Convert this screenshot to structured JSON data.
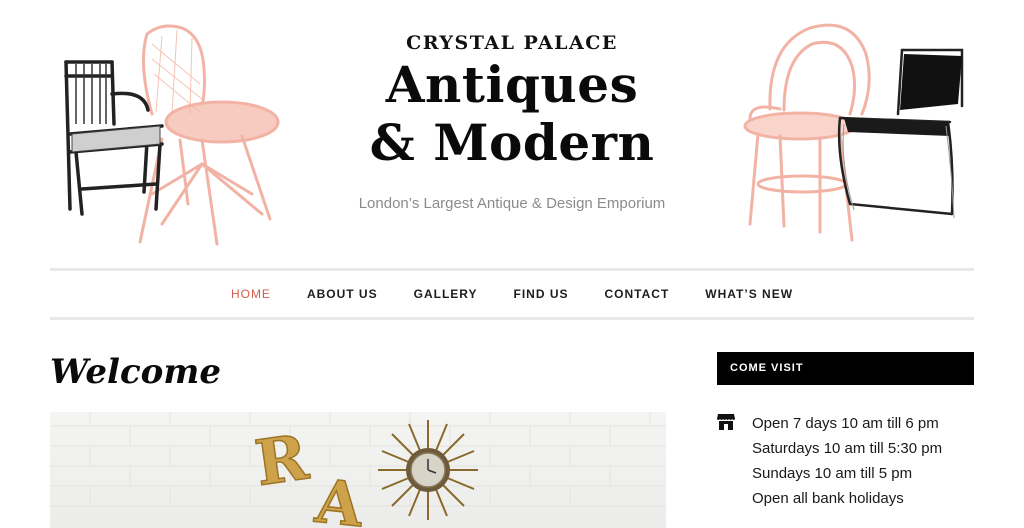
{
  "header": {
    "kicker": "CRYSTAL PALACE",
    "brand_line_1": "Antiques",
    "brand_line_2": "& Modern",
    "tagline": "London’s Largest Antique & Design Emporium"
  },
  "nav": {
    "items": [
      {
        "label": "HOME",
        "active": true
      },
      {
        "label": "ABOUT US",
        "active": false
      },
      {
        "label": "GALLERY",
        "active": false
      },
      {
        "label": "FIND US",
        "active": false
      },
      {
        "label": "CONTACT",
        "active": false
      },
      {
        "label": "WHAT’S NEW",
        "active": false
      }
    ]
  },
  "main": {
    "heading": "Welcome",
    "hero_letters": [
      "R",
      "A"
    ]
  },
  "sidebar": {
    "widget_title": "COME VISIT",
    "icon": "store-icon",
    "hours": [
      "Open 7 days 10 am till 6 pm",
      "Saturdays 10 am till 5:30 pm",
      "Sundays 10 am till 5 pm",
      "Open all bank holidays"
    ]
  },
  "colors": {
    "accent": "#d55b4c",
    "chair_pink": "#f3b3a4",
    "widget_bg": "#000000",
    "divider": "#e9e9e9"
  }
}
